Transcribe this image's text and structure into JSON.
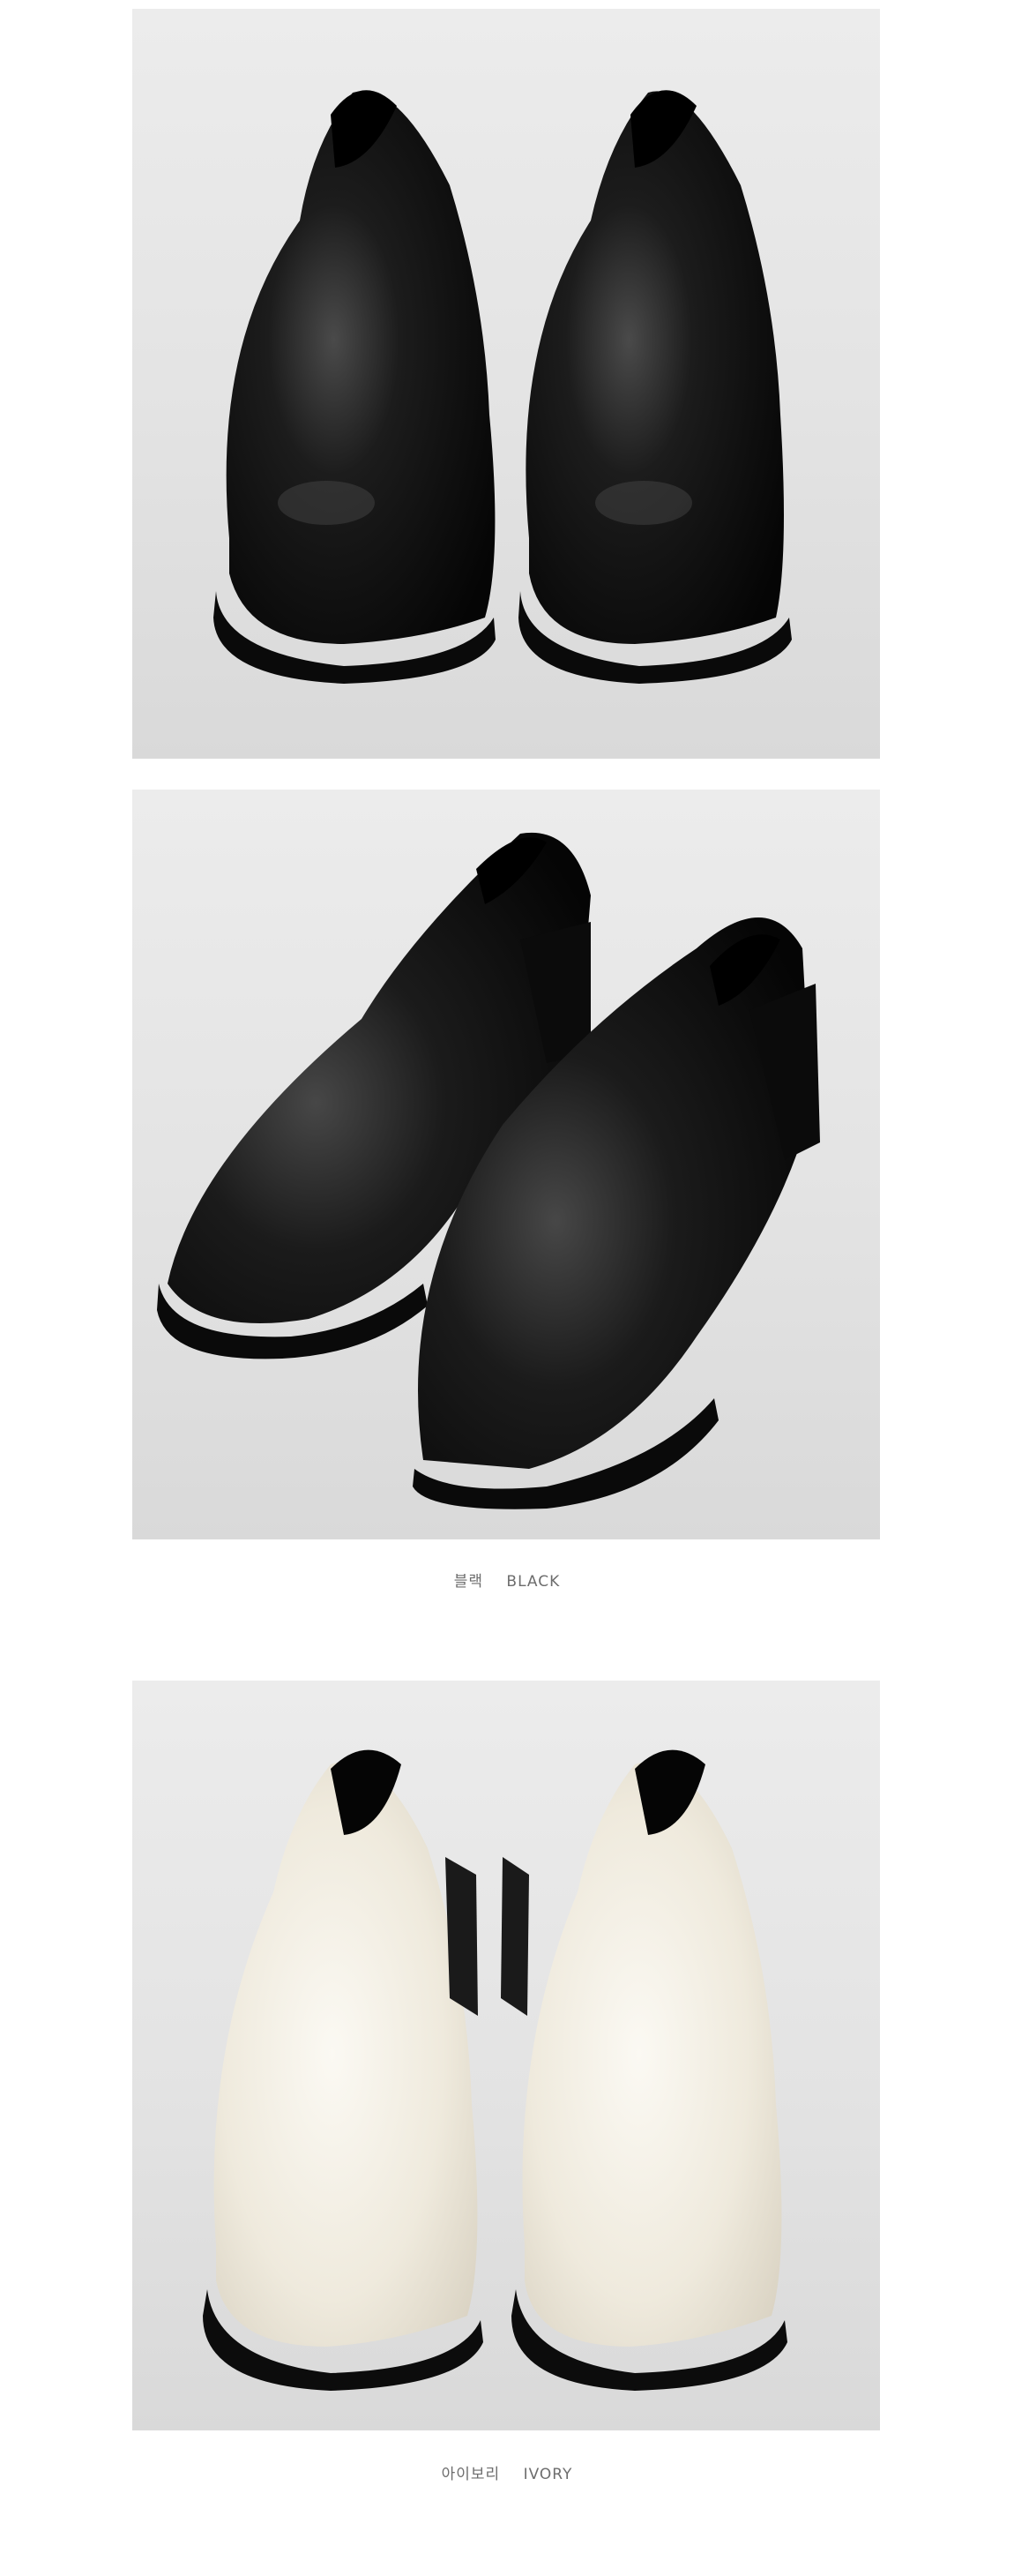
{
  "photos": [
    {
      "name": "black-pair-front",
      "color": "#111111"
    },
    {
      "name": "black-pair-angle",
      "color": "#111111"
    },
    {
      "name": "ivory-pair-front",
      "color": "#f1ede2"
    }
  ],
  "captions": {
    "black": {
      "ko": "블랙",
      "en": "BLACK"
    },
    "ivory": {
      "ko": "아이보리",
      "en": "IVORY"
    }
  },
  "colors": {
    "background": "#ffffff",
    "photo_backdrop": "#e3e3e3",
    "caption_text": "#6d6d6d",
    "black_leather": "#111111",
    "ivory_leather": "#f1ede2"
  }
}
